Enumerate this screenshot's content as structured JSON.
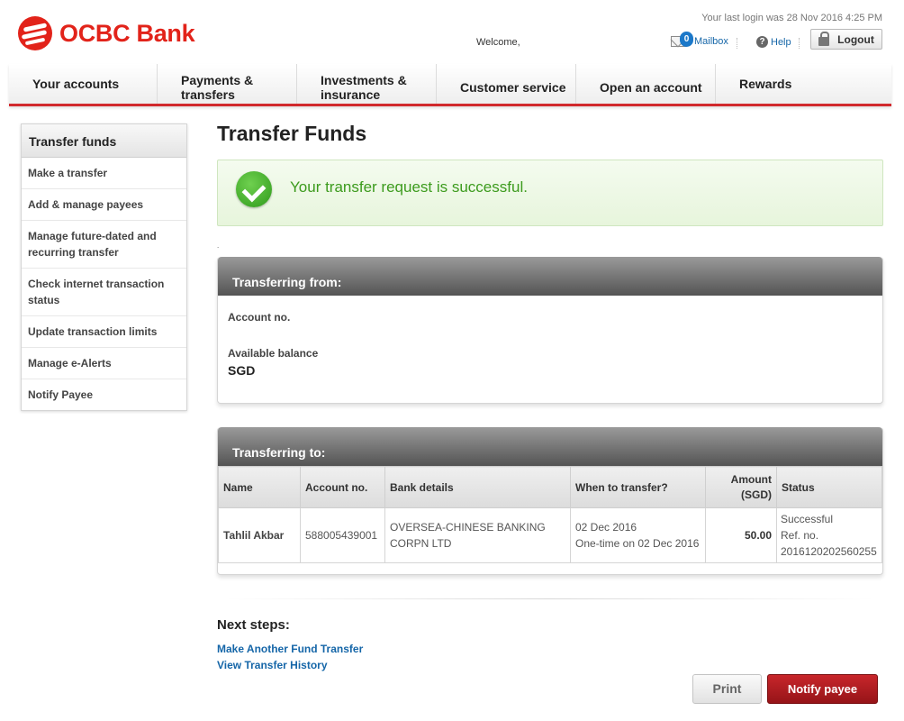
{
  "header": {
    "brand": "OCBC Bank",
    "last_login": "Your last login was 28 Nov 2016 4:25 PM",
    "welcome": "Welcome,",
    "mailbox_count": "0",
    "mailbox_label": "Mailbox",
    "help_label": "Help",
    "logout_label": "Logout"
  },
  "nav": [
    {
      "label": "Your accounts"
    },
    {
      "label": "Payments & transfers"
    },
    {
      "label": "Investments & insurance"
    },
    {
      "label": "Customer service"
    },
    {
      "label": "Open an account"
    },
    {
      "label": "Rewards"
    }
  ],
  "sidebar": {
    "title": "Transfer funds",
    "items": [
      {
        "label": "Make a transfer"
      },
      {
        "label": "Add & manage payees"
      },
      {
        "label": "Manage future-dated and recurring transfer"
      },
      {
        "label": "Check internet transaction status"
      },
      {
        "label": "Update transaction limits"
      },
      {
        "label": "Manage e-Alerts"
      },
      {
        "label": "Notify Payee"
      }
    ]
  },
  "main": {
    "title": "Transfer Funds",
    "success_message": "Your transfer request is successful.",
    "dot": ".",
    "from": {
      "heading": "Transferring from:",
      "account_label": "Account no.",
      "balance_label": "Available balance",
      "balance_value": "SGD"
    },
    "to": {
      "heading": "Transferring to:",
      "columns": [
        "Name",
        "Account no.",
        "Bank details",
        "When to transfer?",
        "Amount (SGD)",
        "Status"
      ],
      "row": {
        "name": "Tahlil Akbar",
        "account": "588005439001",
        "bank": "OVERSEA-CHINESE BANKING CORPN LTD",
        "when_date": "02 Dec 2016",
        "when_detail": "One-time on 02 Dec 2016",
        "amount": "50.00",
        "status": "Successful",
        "ref": "Ref. no. 2016120202560255"
      }
    },
    "next_steps": {
      "title": "Next steps:",
      "links": [
        "Make Another Fund Transfer",
        "View Transfer History"
      ]
    },
    "buttons": {
      "print": "Print",
      "notify": "Notify payee"
    }
  }
}
